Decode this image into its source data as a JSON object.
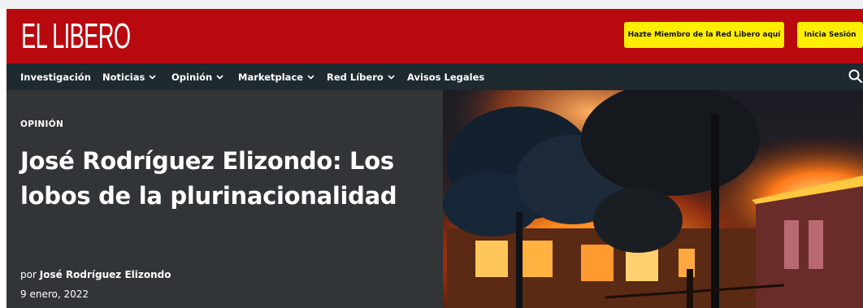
{
  "brand": {
    "logo_text": "EL LIBERO"
  },
  "header": {
    "member_button": "Hazte Miembro de la Red Libero aquí",
    "login_button": "Inicia Sesión",
    "accent_color": "#b8090e",
    "button_color": "#ffee00"
  },
  "nav": {
    "items": [
      {
        "label": "Investigación",
        "has_dropdown": false
      },
      {
        "label": "Noticias",
        "has_dropdown": true
      },
      {
        "label": "Opinión",
        "has_dropdown": true
      },
      {
        "label": "Marketplace",
        "has_dropdown": true
      },
      {
        "label": "Red Líbero",
        "has_dropdown": true
      },
      {
        "label": "Avisos Legales",
        "has_dropdown": false
      }
    ],
    "search_icon": "search-icon"
  },
  "article": {
    "section": "OPINIÓN",
    "title": "José Rodríguez Elizondo: Los lobos de la plurinacionalidad",
    "byline_prefix": "por",
    "author": "José Rodríguez Elizondo",
    "date": "9 enero, 2022",
    "image": "burning-building-photo"
  }
}
